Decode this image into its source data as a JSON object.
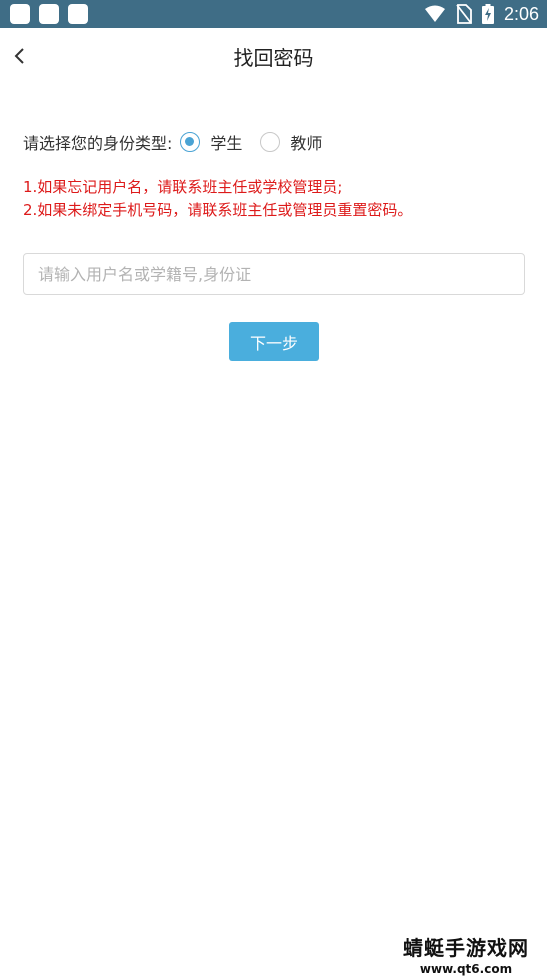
{
  "status_bar": {
    "time": "2:06",
    "bg_color": "#3f6d86",
    "icons": [
      "app-notification-icon",
      "app-notification-icon",
      "app-notification-icon",
      "wifi-icon",
      "no-sim-icon",
      "battery-charging-icon"
    ]
  },
  "header": {
    "title": "找回密码",
    "back_icon": "chevron-left-icon"
  },
  "identity": {
    "label": "请选择您的身份类型:",
    "options": [
      {
        "label": "学生",
        "selected": true
      },
      {
        "label": "教师",
        "selected": false
      }
    ],
    "accent_color": "#4aa3d4"
  },
  "notice": {
    "lines": [
      "1.如果忘记用户名，请联系班主任或学校管理员;",
      "2.如果未绑定手机号码，请联系班主任或管理员重置密码。"
    ],
    "color": "#dd1a1a"
  },
  "form": {
    "input_value": "",
    "input_placeholder": "请输入用户名或学籍号,身份证",
    "next_label": "下一步",
    "button_color": "#4aaedd"
  },
  "watermark": {
    "title": "蜻蜓手游戏网",
    "url": "www.qt6.com"
  }
}
